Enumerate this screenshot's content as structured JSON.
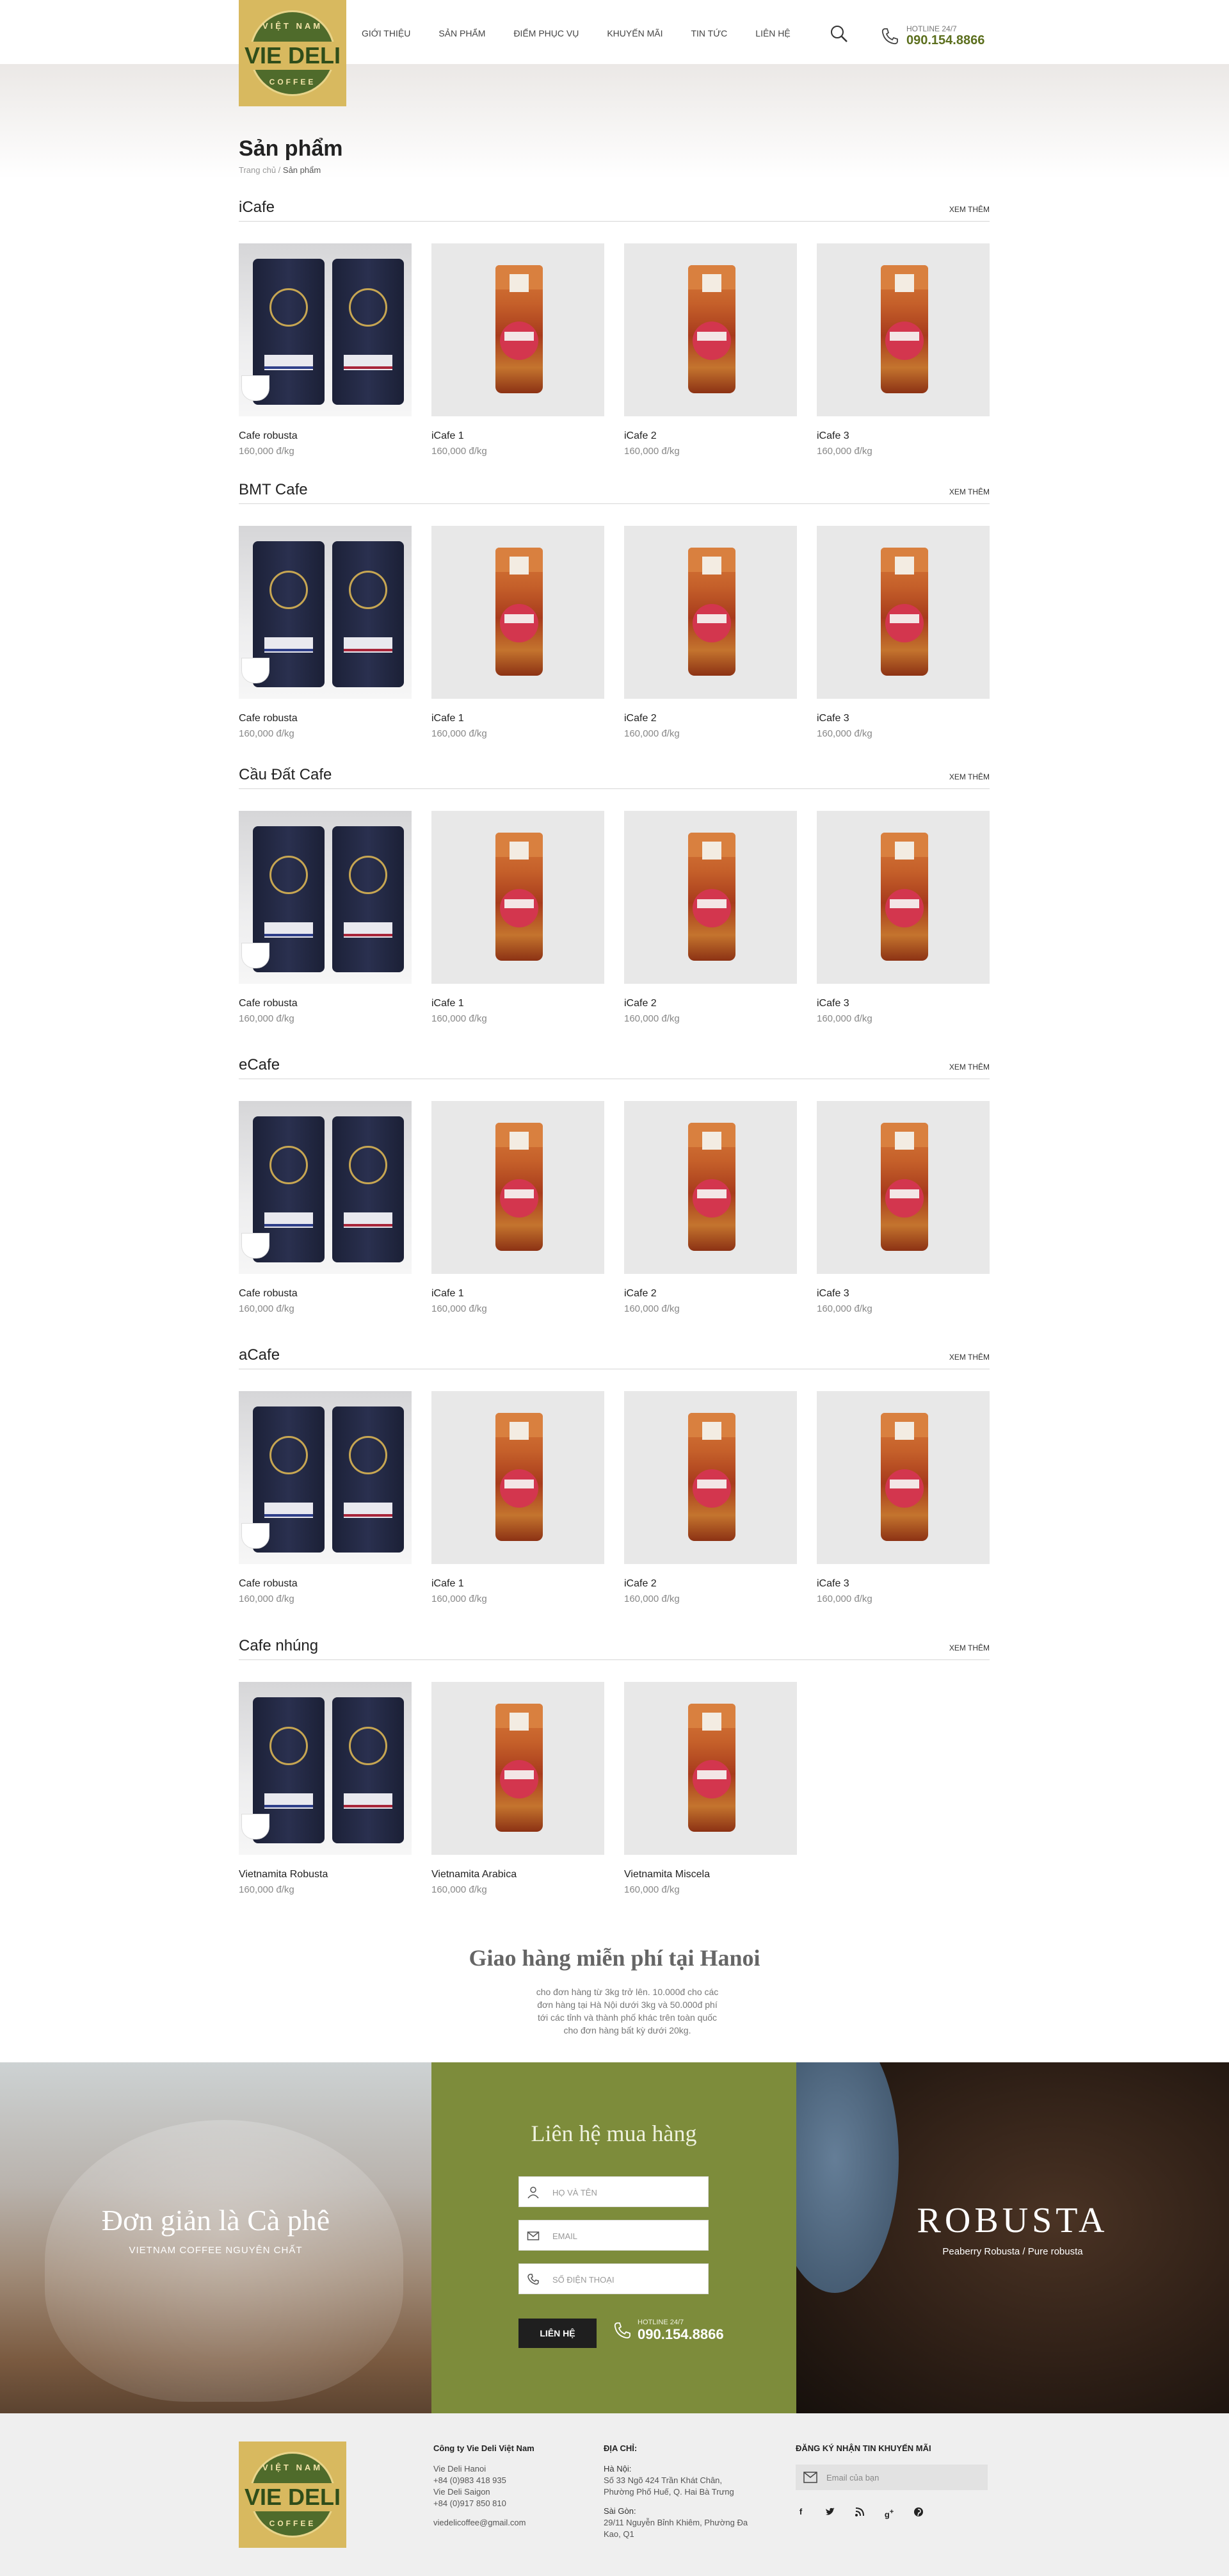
{
  "header": {
    "logo": {
      "top": "VIỆT NAM",
      "main": "VIE DELI",
      "bottom": "COFFEE"
    },
    "nav": [
      "GIỚI THIỆU",
      "SẢN PHẨM",
      "ĐIỂM PHỤC VỤ",
      "KHUYẾN MÃI",
      "TIN TỨC",
      "LIÊN HỆ"
    ],
    "hotline_label": "HOTLINE 24/7",
    "hotline_number": "090.154.8866"
  },
  "page": {
    "title": "Sản phẩm",
    "breadcrumb": {
      "home": "Trang chủ",
      "sep": " / ",
      "current": "Sản phẩm"
    }
  },
  "sections": [
    {
      "title": "iCafe",
      "more": "XEM THÊM",
      "items": [
        {
          "name": "Cafe robusta",
          "price": "160,000 đ/kg"
        },
        {
          "name": "iCafe 1",
          "price": "160,000 đ/kg"
        },
        {
          "name": "iCafe 2",
          "price": "160,000 đ/kg"
        },
        {
          "name": "iCafe 3",
          "price": "160,000 đ/kg"
        }
      ]
    },
    {
      "title": "BMT Cafe",
      "more": "XEM THÊM",
      "items": [
        {
          "name": "Cafe robusta",
          "price": "160,000 đ/kg"
        },
        {
          "name": "iCafe 1",
          "price": "160,000 đ/kg"
        },
        {
          "name": "iCafe 2",
          "price": "160,000 đ/kg"
        },
        {
          "name": "iCafe 3",
          "price": "160,000 đ/kg"
        }
      ]
    },
    {
      "title": "Cầu Đất Cafe",
      "more": "XEM THÊM",
      "items": [
        {
          "name": "Cafe robusta",
          "price": "160,000 đ/kg"
        },
        {
          "name": "iCafe 1",
          "price": "160,000 đ/kg"
        },
        {
          "name": "iCafe 2",
          "price": "160,000 đ/kg"
        },
        {
          "name": "iCafe 3",
          "price": "160,000 đ/kg"
        }
      ]
    },
    {
      "title": "eCafe",
      "more": "XEM THÊM",
      "items": [
        {
          "name": "Cafe robusta",
          "price": "160,000 đ/kg"
        },
        {
          "name": "iCafe 1",
          "price": "160,000 đ/kg"
        },
        {
          "name": "iCafe 2",
          "price": "160,000 đ/kg"
        },
        {
          "name": "iCafe 3",
          "price": "160,000 đ/kg"
        }
      ]
    },
    {
      "title": "aCafe",
      "more": "XEM THÊM",
      "items": [
        {
          "name": "Cafe robusta",
          "price": "160,000 đ/kg"
        },
        {
          "name": "iCafe 1",
          "price": "160,000 đ/kg"
        },
        {
          "name": "iCafe 2",
          "price": "160,000 đ/kg"
        },
        {
          "name": "iCafe 3",
          "price": "160,000 đ/kg"
        }
      ]
    },
    {
      "title": "Cafe nhúng",
      "more": "XEM THÊM",
      "items": [
        {
          "name": "Vietnamita Robusta",
          "price": "160,000 đ/kg"
        },
        {
          "name": "Vietnamita Arabica",
          "price": "160,000 đ/kg"
        },
        {
          "name": "Vietnamita Miscela",
          "price": "160,000 đ/kg"
        }
      ]
    }
  ],
  "delivery": {
    "title": "Giao hàng miễn phí tại Hanoi",
    "desc": "cho đơn hàng từ 3kg trở lên. 10.000đ cho các đơn hàng tại Hà Nội dưới 3kg và 50.000đ phí tới các tỉnh và thành phố khác trên toàn quốc cho đơn hàng bất kỳ dưới 20kg."
  },
  "banner_left": {
    "title": "Đơn giản là Cà phê",
    "subtitle": "VIETNAM COFFEE NGUYÊN CHẤT"
  },
  "contact_form": {
    "title": "Liên hệ mua hàng",
    "name_placeholder": "HỌ VÀ TÊN",
    "email_placeholder": "EMAIL",
    "phone_placeholder": "SỐ ĐIỆN THOẠI",
    "submit": "LIÊN HỆ",
    "hotline_label": "HOTLINE 24/7",
    "hotline_number": "090.154.8866"
  },
  "banner_right": {
    "title": "ROBUSTA",
    "subtitle": "Peaberry Robusta / Pure robusta"
  },
  "footer": {
    "company": "Công ty Vie Deli Việt Nam",
    "hanoi_label": "Vie Deli Hanoi",
    "hanoi_phone": "+84 (0)983 418 935",
    "saigon_label": "Vie Deli Saigon",
    "saigon_phone": "+84 (0)917 850 810",
    "email": "viedelicoffee@gmail.com",
    "address_title": "ĐỊA CHỈ:",
    "hanoi_addr_label": "Hà Nội:",
    "hanoi_addr": "Số 33 Ngõ 424 Trần Khát Chân, Phường Phố Huế, Q. Hai Bà Trưng",
    "saigon_addr_label": "Sài Gòn:",
    "saigon_addr": "29/11 Nguyễn Bỉnh Khiêm, Phường Đa Kao, Q1",
    "newsletter_title": "ĐĂNG KÝ NHẬN TIN KHUYẾN MÃI",
    "newsletter_placeholder": "Email của bạn",
    "socials": [
      "facebook-icon",
      "twitter-icon",
      "rss-icon",
      "google-plus-icon",
      "pinterest-icon"
    ]
  },
  "colors": {
    "brand_gold": "#d8b95f",
    "brand_green": "#7d8c3b",
    "hotline_green": "#5c6f1e"
  }
}
